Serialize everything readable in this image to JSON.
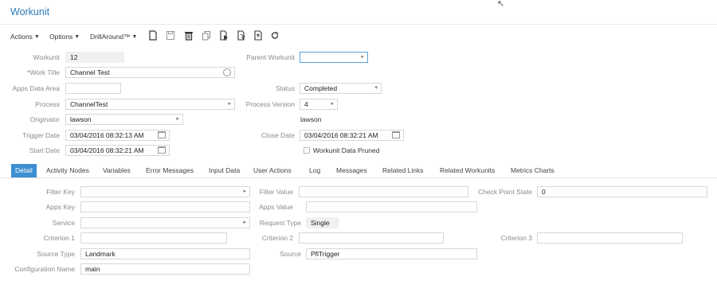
{
  "header": {
    "title": "Workunit"
  },
  "toolbar": {
    "actions_label": "Actions",
    "options_label": "Options",
    "drill_label": "DrillAround™",
    "icons": [
      "new-document-icon",
      "save-icon",
      "delete-icon",
      "copy-icon",
      "run-icon",
      "export-icon",
      "import-icon",
      "refresh-icon"
    ]
  },
  "form": {
    "workunit_label": "Workunit",
    "workunit_value": "12",
    "parent_workunit_label": "Parent Workunit",
    "parent_workunit_value": "",
    "work_title_label": "*Work Title",
    "work_title_value": "Channel Test",
    "apps_data_area_label": "Apps Data Area",
    "apps_data_area_value": "",
    "status_label": "Status",
    "status_value": "Completed",
    "process_label": "Process",
    "process_value": "ChannelTest",
    "process_version_label": "Process Version",
    "process_version_value": "4",
    "originator_label": "Originator",
    "originator_value": "lawson",
    "originator_name": "lawson",
    "trigger_date_label": "Trigger Date",
    "trigger_date_value": "03/04/2016 08:32:13 AM",
    "close_date_label": "Close Date",
    "close_date_value": "03/04/2016 08:32:21 AM",
    "start_date_label": "Start Date",
    "start_date_value": "03/04/2016 08:32:21 AM",
    "pruned_label": "Workunit Data Pruned"
  },
  "tabs": [
    {
      "label": "Detail"
    },
    {
      "label": "Activity Nodes"
    },
    {
      "label": "Variables"
    },
    {
      "label": "Error Messages"
    },
    {
      "label": "Input Data"
    },
    {
      "label": "User Actions"
    },
    {
      "label": "Log"
    },
    {
      "label": "Messages"
    },
    {
      "label": "Related Links"
    },
    {
      "label": "Related Workunits"
    },
    {
      "label": "Metrics Charts"
    }
  ],
  "detail": {
    "filter_key_label": "Filter Key",
    "filter_key_value": "",
    "filter_value_label": "Filter Value",
    "filter_value_value": "",
    "check_point_state_label": "Check Point State",
    "check_point_state_value": "0",
    "apps_key_label": "Apps Key",
    "apps_key_value": "",
    "apps_value_label": "Apps Value",
    "apps_value_value": "",
    "service_label": "Service",
    "service_value": "",
    "request_type_label": "Request Type",
    "request_type_value": "Single",
    "criterion1_label": "Criterion 1",
    "criterion1_value": "",
    "criterion2_label": "Criterion 2",
    "criterion2_value": "",
    "criterion3_label": "Criterion 3",
    "criterion3_value": "",
    "source_type_label": "Source Type",
    "source_type_value": "Landmark",
    "source_label": "Source",
    "source_value": "PflTrigger",
    "configuration_name_label": "Configuration Name",
    "configuration_name_value": "main"
  }
}
